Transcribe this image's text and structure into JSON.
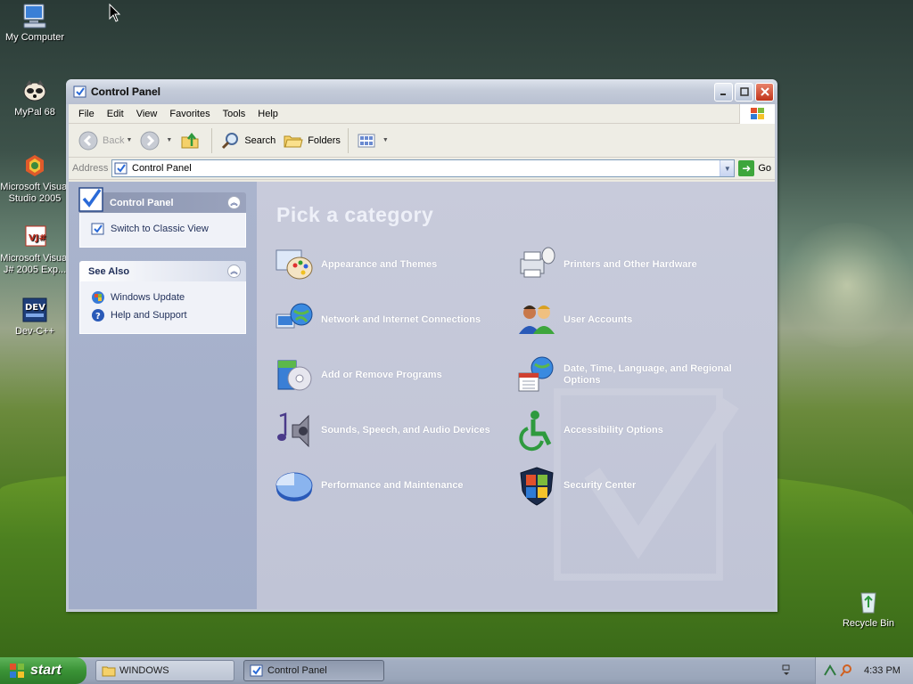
{
  "desktop": {
    "icons": [
      {
        "label": "My Computer",
        "icon": "my-computer-icon"
      },
      {
        "label": "MyPal 68",
        "icon": "mypal-icon"
      },
      {
        "label": "Microsoft Visual Studio 2005",
        "icon": "visual-studio-icon"
      },
      {
        "label": "Microsoft Visual J# 2005 Exp...",
        "icon": "visual-jsharp-icon"
      },
      {
        "label": "Dev-C++",
        "icon": "dev-cpp-icon"
      },
      {
        "label": "Recycle Bin",
        "icon": "recycle-bin-icon"
      }
    ]
  },
  "window": {
    "title": "Control Panel",
    "menu": [
      "File",
      "Edit",
      "View",
      "Favorites",
      "Tools",
      "Help"
    ],
    "toolbar": {
      "back_label": "Back",
      "search_label": "Search",
      "folders_label": "Folders"
    },
    "address": {
      "label": "Address",
      "value": "Control Panel",
      "go_label": "Go"
    },
    "sidebar": {
      "control_panel_box": {
        "title": "Control Panel",
        "links": [
          "Switch to Classic View"
        ]
      },
      "see_also_box": {
        "title": "See Also",
        "links": [
          "Windows Update",
          "Help and Support"
        ]
      }
    },
    "main": {
      "heading": "Pick a category",
      "categories": [
        {
          "label": "Appearance and Themes",
          "icon": "appearance-themes-icon"
        },
        {
          "label": "Printers and Other Hardware",
          "icon": "printers-hardware-icon"
        },
        {
          "label": "Network and Internet Connections",
          "icon": "network-internet-icon"
        },
        {
          "label": "User Accounts",
          "icon": "user-accounts-icon"
        },
        {
          "label": "Add or Remove Programs",
          "icon": "add-remove-programs-icon"
        },
        {
          "label": "Date, Time, Language, and Regional Options",
          "icon": "date-time-regional-icon"
        },
        {
          "label": "Sounds, Speech, and Audio Devices",
          "icon": "sounds-audio-icon"
        },
        {
          "label": "Accessibility Options",
          "icon": "accessibility-icon"
        },
        {
          "label": "Performance and Maintenance",
          "icon": "performance-maintenance-icon"
        },
        {
          "label": "Security Center",
          "icon": "security-center-icon"
        }
      ]
    }
  },
  "taskbar": {
    "start_label": "start",
    "buttons": [
      "WINDOWS",
      "Control Panel"
    ],
    "clock": "4:33 PM"
  }
}
